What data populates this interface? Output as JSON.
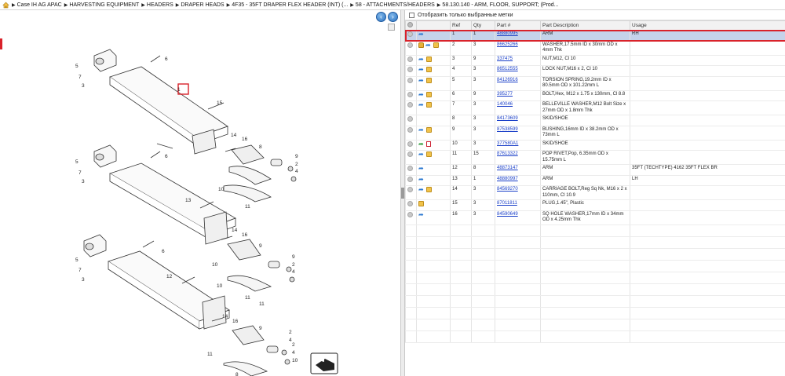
{
  "breadcrumb": {
    "items": [
      "Case IH AG APAC",
      "HARVESTING EQUIPMENT",
      "HEADERS",
      "DRAPER HEADS",
      "4F35 - 35FT DRAPER FLEX HEADER (INT) (...",
      "58 - ATTACHMENTS/HEADERS",
      "58.130.140 - ARM, FLOOR, SUPPORT; (Prod..."
    ]
  },
  "filter": {
    "label": "Отобразить только выбранные метки"
  },
  "table": {
    "headers": {
      "ref": "Ref",
      "qty": "Qty",
      "part": "Part #",
      "desc": "Part Description",
      "usage": "Usage"
    },
    "rows": [
      {
        "ref": "1",
        "qty": "1",
        "part": "48880995",
        "desc": "ARM",
        "usage": "RH",
        "icons": [
          "blue"
        ]
      },
      {
        "ref": "2",
        "qty": "3",
        "part": "86625266",
        "desc": "WASHER,17.5mm ID x 30mm OD x 4mm Thk",
        "usage": "",
        "icons": [
          "lock",
          "blue",
          "box"
        ]
      },
      {
        "ref": "3",
        "qty": "9",
        "part": "337475",
        "desc": "NUT,M12, Cl 10",
        "usage": "",
        "icons": [
          "blue",
          "box"
        ]
      },
      {
        "ref": "4",
        "qty": "3",
        "part": "86512555",
        "desc": "LOCK NUT,M16 x 2, Cl 10",
        "usage": "",
        "icons": [
          "blue",
          "box"
        ]
      },
      {
        "ref": "5",
        "qty": "3",
        "part": "84126916",
        "desc": "TORSION SPRING,19.2mm ID x 80.5mm OD x 101.22mm L",
        "usage": "",
        "icons": [
          "blue",
          "box"
        ]
      },
      {
        "ref": "6",
        "qty": "9",
        "part": "395277",
        "desc": "BOLT,Hex, M12 x 1.75 x 130mm, Cl 8.8",
        "usage": "",
        "icons": [
          "blue",
          "box"
        ]
      },
      {
        "ref": "7",
        "qty": "3",
        "part": "140046",
        "desc": "BELLEVILLE WASHER,M12 Bolt Size x 27mm OD x 1.8mm Thk",
        "usage": "",
        "icons": [
          "blue",
          "box"
        ]
      },
      {
        "ref": "8",
        "qty": "3",
        "part": "84173609",
        "desc": "SKID/SHOE",
        "usage": "",
        "icons": []
      },
      {
        "ref": "9",
        "qty": "3",
        "part": "87538599",
        "desc": "BUSHING,16mm ID x 38.2mm OD x 73mm L",
        "usage": "",
        "icons": [
          "blue",
          "box"
        ]
      },
      {
        "ref": "10",
        "qty": "3",
        "part": "377580A1",
        "desc": "SKID/SHOE",
        "usage": "",
        "icons": [
          "green",
          "doc"
        ]
      },
      {
        "ref": "11",
        "qty": "15",
        "part": "87613322",
        "desc": "POP RIVET,Pop, 6.35mm OD x 15.75mm L",
        "usage": "",
        "icons": [
          "blue",
          "box"
        ]
      },
      {
        "ref": "12",
        "qty": "8",
        "part": "48873147",
        "desc": "ARM",
        "usage": "35FT (TECHTYPE) 4162 35FT FLEX BR",
        "icons": [
          "blue"
        ]
      },
      {
        "ref": "13",
        "qty": "1",
        "part": "48880997",
        "desc": "ARM",
        "usage": "LH",
        "icons": [
          "blue"
        ]
      },
      {
        "ref": "14",
        "qty": "3",
        "part": "84569270",
        "desc": "CARRIAGE BOLT,Reg Sq Nk, M16 x 2 x 110mm, Cl 10.9",
        "usage": "",
        "icons": [
          "blue",
          "box"
        ]
      },
      {
        "ref": "15",
        "qty": "3",
        "part": "87011811",
        "desc": "PLUG,1.45\", Plastic",
        "usage": "",
        "icons": [
          "box"
        ]
      },
      {
        "ref": "16",
        "qty": "3",
        "part": "84590649",
        "desc": "SQ HOLE WASHER,17mm ID x 34mm OD x 4.25mm Thk",
        "usage": "",
        "icons": [
          "blue"
        ]
      }
    ]
  },
  "diagram": {
    "callouts": [
      "6",
      "5",
      "7",
      "3",
      "1",
      "15",
      "14",
      "16",
      "8",
      "9",
      "2",
      "4",
      "10",
      "11",
      "6",
      "5",
      "7",
      "3",
      "13",
      "14",
      "16",
      "9",
      "2",
      "4",
      "10",
      "11",
      "6",
      "5",
      "7",
      "3",
      "12",
      "14",
      "16",
      "9",
      "2",
      "4",
      "10",
      "11",
      "8",
      "9",
      "2",
      "4",
      "10",
      "11"
    ]
  },
  "nav": {
    "back": "‹",
    "forward": "›"
  },
  "colors": {
    "selection": "#c5d3ea",
    "highlight": "#d9222a",
    "link": "#1a3fc8"
  }
}
